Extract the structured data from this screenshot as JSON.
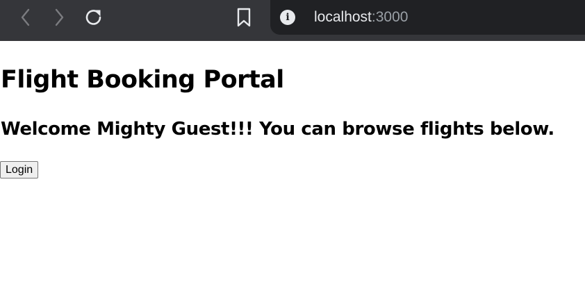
{
  "browser": {
    "address_bar": {
      "host": "localhost",
      "port": ":3000"
    },
    "icons": {
      "back": "back-arrow-icon",
      "forward": "forward-arrow-icon",
      "reload": "reload-icon",
      "bookmark": "bookmark-icon",
      "site_info": "info-icon"
    },
    "colors": {
      "toolbar": "#35363a",
      "omnibox": "#202124"
    }
  },
  "page": {
    "title": "Flight Booking Portal",
    "welcome": "Welcome Mighty Guest!!! You can browse flights below.",
    "login_label": "Login"
  }
}
